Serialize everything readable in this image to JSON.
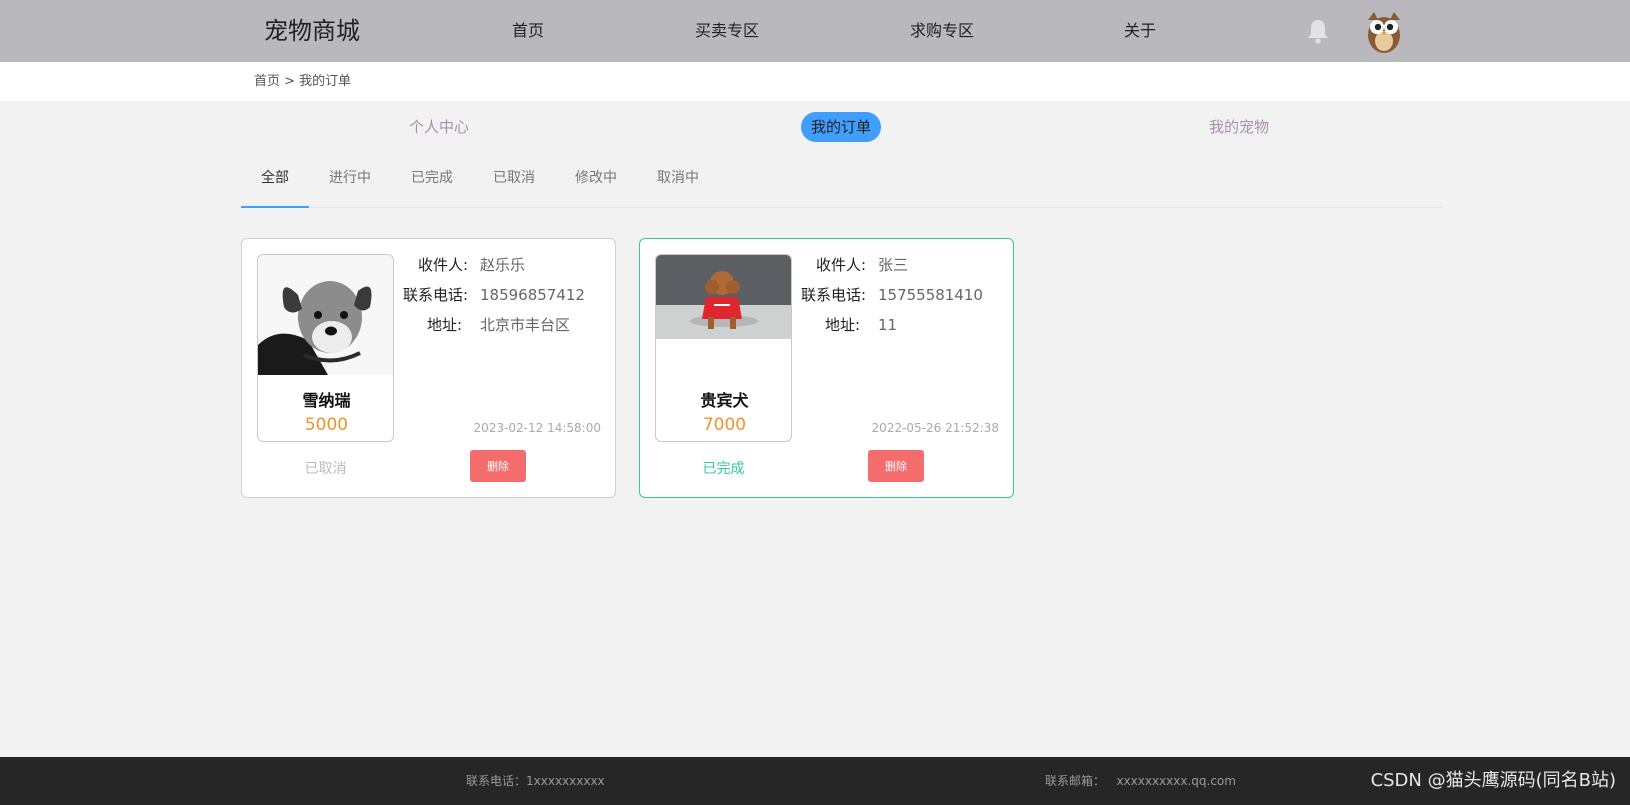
{
  "header": {
    "logo": "宠物商城",
    "nav": [
      "首页",
      "买卖专区",
      "求购专区",
      "关于"
    ]
  },
  "breadcrumb": "首页 > 我的订单",
  "center_tabs": [
    "个人中心",
    "我的订单",
    "我的宠物"
  ],
  "status_tabs": [
    "全部",
    "进行中",
    "已完成",
    "已取消",
    "修改中",
    "取消中"
  ],
  "labels": {
    "receiver": "收件人:",
    "phone": "联系电话:",
    "address": "地址:"
  },
  "orders": [
    {
      "pet_name": "雪纳瑞",
      "price": "5000",
      "receiver": "赵乐乐",
      "phone": "18596857412",
      "address": "北京市丰台区",
      "time": "2023-02-12 14:58:00",
      "status": "已取消",
      "delete_label": "删除"
    },
    {
      "pet_name": "贵宾犬",
      "price": "7000",
      "receiver": "张三",
      "phone": "15755581410",
      "address": "11",
      "time": "2022-05-26 21:52:38",
      "status": "已完成",
      "delete_label": "删除"
    }
  ],
  "footer": {
    "phone": "联系电话：1xxxxxxxxxx",
    "email": "联系邮箱：   xxxxxxxxxx.qq.com",
    "watermark": "CSDN @猫头鹰源码(同名B站)"
  },
  "colors": {
    "header_bg": "#b8b8bd",
    "accent": "#409eff",
    "price": "#f0932b",
    "done": "#36c8a0",
    "danger": "#f56c6c",
    "cancelled_text": "#bbbbbb"
  },
  "icons": [
    "bell-icon",
    "owl-avatar"
  ]
}
